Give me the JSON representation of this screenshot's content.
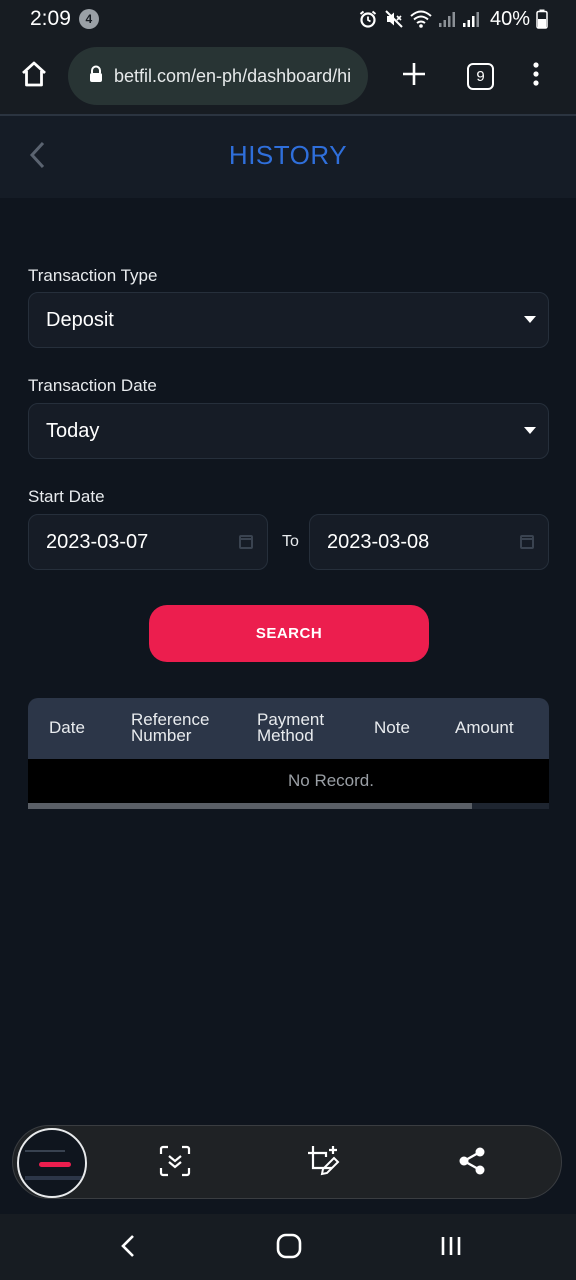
{
  "status_bar": {
    "time": "2:09",
    "notification_count": "4",
    "battery": "40%"
  },
  "browser": {
    "url": "betfil.com/en-ph/dashboard/hi",
    "tab_count": "9"
  },
  "header": {
    "title": "HISTORY"
  },
  "form": {
    "transaction_type_label": "Transaction Type",
    "transaction_type_value": "Deposit",
    "transaction_date_label": "Transaction Date",
    "transaction_date_value": "Today",
    "start_date_label": "Start Date",
    "start_date_value": "2023-03-07",
    "to_label": "To",
    "end_date_value": "2023-03-08",
    "search_label": "SEARCH"
  },
  "table": {
    "columns": [
      "Date",
      "Reference Number",
      "Payment Method",
      "Note",
      "Amount"
    ],
    "empty_message": "No Record."
  },
  "colors": {
    "accent_title": "#2f6fdb",
    "search_button": "#ec1e4e",
    "background": "#0f151e",
    "table_header": "#2c3648"
  },
  "icons": {
    "status": [
      "alarm-icon",
      "mute-icon",
      "wifi-icon",
      "signal-icon",
      "signal-icon",
      "battery-icon"
    ],
    "browser": [
      "home-icon",
      "lock-icon",
      "plus-icon",
      "tabs-icon",
      "more-vert-icon"
    ],
    "toolbar": [
      "scroll-capture-icon",
      "crop-edit-icon",
      "share-icon"
    ],
    "nav": [
      "back-icon",
      "home-icon",
      "recents-icon"
    ]
  }
}
